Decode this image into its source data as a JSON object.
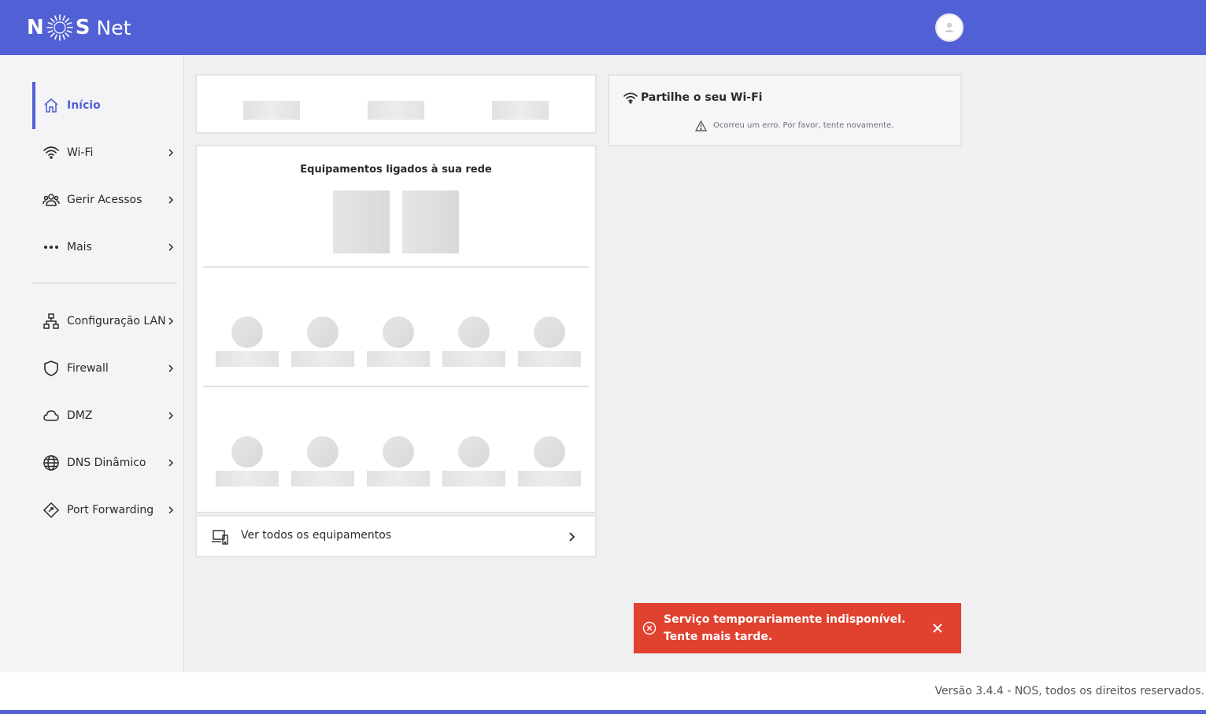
{
  "brand": {
    "letter_n": "N",
    "letter_s": "S",
    "suffix": "Net"
  },
  "sidebar": {
    "items": [
      {
        "label": "Início",
        "icon": "home-icon",
        "active": true
      },
      {
        "label": "Wi-Fi",
        "icon": "wifi-icon"
      },
      {
        "label": "Gerir Acessos",
        "icon": "users-icon"
      },
      {
        "label": "Mais",
        "icon": "more-icon"
      },
      {
        "label": "Configuração LAN",
        "icon": "lan-icon"
      },
      {
        "label": "Firewall",
        "icon": "shield-icon"
      },
      {
        "label": "DMZ",
        "icon": "cloud-icon"
      },
      {
        "label": "DNS Dinâmico",
        "icon": "globe-icon"
      },
      {
        "label": "Port Forwarding",
        "icon": "port-forwarding-icon"
      }
    ]
  },
  "devices": {
    "title": "Equipamentos ligados à sua rede",
    "see_all": "Ver todos os equipamentos"
  },
  "wifi_share": {
    "title": "Partilhe o seu Wi-Fi",
    "error": "Ocorreu um erro. Por favor, tente novamente."
  },
  "toast": {
    "message": "Serviço temporariamente indisponível. Tente mais tarde."
  },
  "footer": {
    "version": "Versão 3.4.4 - NOS, todos os direitos reservados."
  },
  "colors": {
    "brand": "#5161d5",
    "error": "#e1412f",
    "background": "#f0f0f2"
  }
}
